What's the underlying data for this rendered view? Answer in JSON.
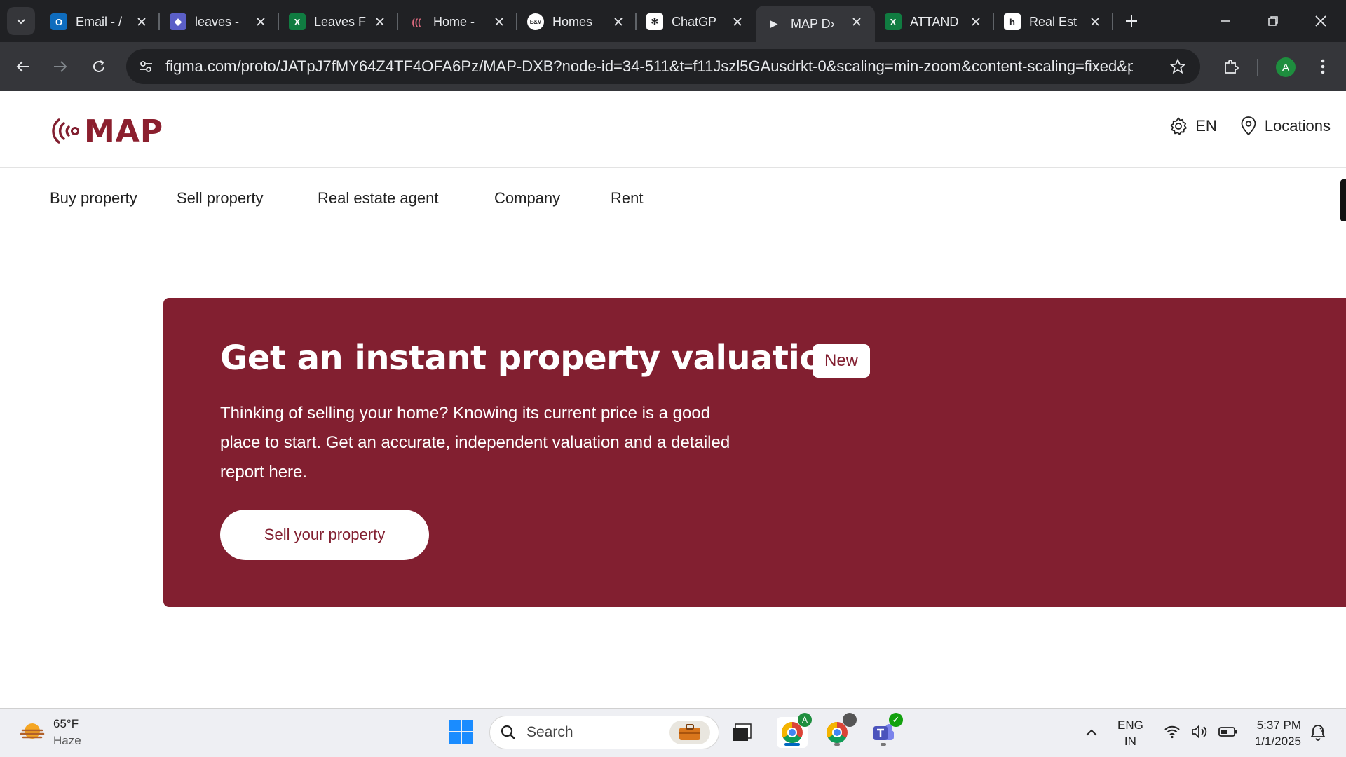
{
  "browser": {
    "tabs": [
      {
        "title": "Email - /",
        "icon": "outlook-icon",
        "color": "#0f6cbd",
        "glyph": "O"
      },
      {
        "title": "leaves -",
        "icon": "copilot-icon",
        "color": "#5b5fc7",
        "glyph": "◆"
      },
      {
        "title": "Leaves F",
        "icon": "excel-icon",
        "color": "#107c41",
        "glyph": "X"
      },
      {
        "title": "Home -",
        "icon": "map-icon",
        "color": "#821f30",
        "glyph": "((("
      },
      {
        "title": "Homes",
        "icon": "eav-icon",
        "color": "#ffffff",
        "glyph": "E&V"
      },
      {
        "title": "ChatGP",
        "icon": "chatgpt-icon",
        "color": "#ffffff",
        "glyph": "✻"
      },
      {
        "title": "MAP D›",
        "icon": "figma-play-icon",
        "color": "#35363a",
        "glyph": "▶"
      },
      {
        "title": "ATTAND",
        "icon": "excel-icon",
        "color": "#107c41",
        "glyph": "X"
      },
      {
        "title": "Real Est",
        "icon": "houzz-icon",
        "color": "#ffffff",
        "glyph": "h"
      }
    ],
    "url": "figma.com/proto/JATpJ7fMY64Z4TF4OFA6Pz/MAP-DXB?node-id=34-511&t=f11Jszl5GAusdrkt-0&scaling=min-zoom&content-scaling=fixed&page-id...",
    "profile_initial": "A"
  },
  "site": {
    "brand": "MAP",
    "brand_color": "#821f30",
    "language": "EN",
    "locations": "Locations",
    "nav": [
      "Buy property",
      "Sell property",
      "Real estate agent",
      "Company",
      "Rent"
    ]
  },
  "hero": {
    "title": "Get an instant property valuation",
    "badge": "New",
    "description": "Thinking of selling your home? Knowing its current price is a good place to start. Get an accurate, independent valuation and a detailed report here.",
    "cta": "Sell your property"
  },
  "taskbar": {
    "temperature": "65°F",
    "condition": "Haze",
    "search_placeholder": "Search",
    "lang_line1": "ENG",
    "lang_line2": "IN",
    "time": "5:37 PM",
    "date": "1/1/2025",
    "chrome_badge": "A"
  }
}
